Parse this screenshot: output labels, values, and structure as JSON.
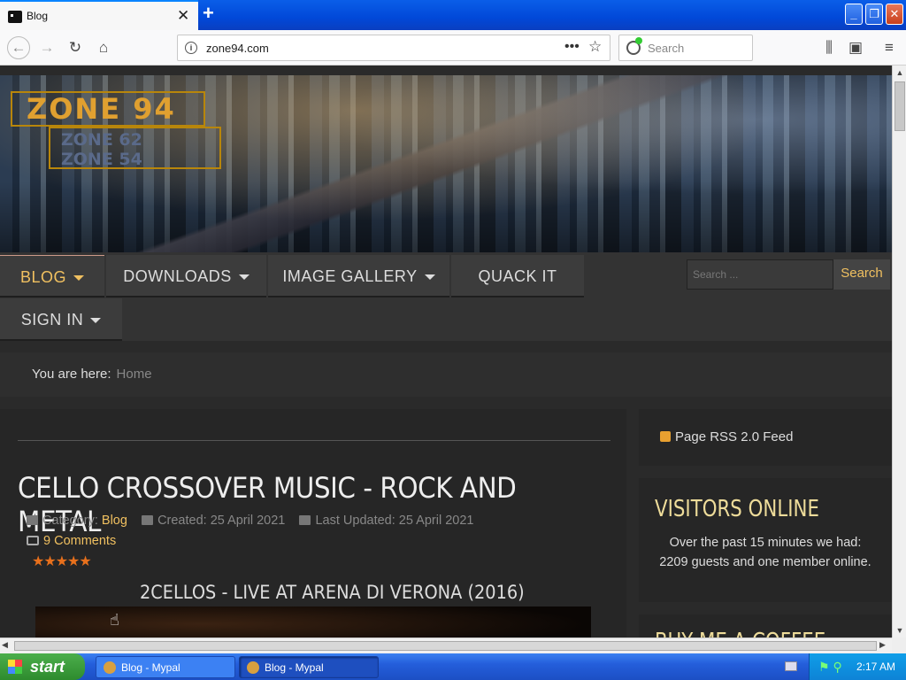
{
  "browser": {
    "tab_title": "Blog",
    "url": "zone94.com",
    "search_placeholder": "Search",
    "buttons": {
      "new_tab": "+",
      "tab_close": "✕",
      "minimize": "_",
      "maximize": "❐",
      "close": "✕"
    }
  },
  "site": {
    "logo_main": "ZONE 94",
    "logo_sub_1": "ZONE 62",
    "logo_sub_2": "ZONE 54",
    "menu": [
      {
        "label": "BLOG",
        "dropdown": true
      },
      {
        "label": "DOWNLOADS",
        "dropdown": true
      },
      {
        "label": "IMAGE GALLERY",
        "dropdown": true
      },
      {
        "label": "QUACK IT",
        "dropdown": false
      },
      {
        "label": "SIGN IN",
        "dropdown": true
      }
    ],
    "search_placeholder": "Search ...",
    "search_button": "Search",
    "breadcrumb_label": "You are here:",
    "breadcrumb_home": "Home"
  },
  "article": {
    "title": "CELLO CROSSOVER MUSIC - ROCK AND METAL",
    "category_label": "Category:",
    "category": "Blog",
    "created": "Created: 25 April 2021",
    "updated": "Last Updated: 25 April 2021",
    "comments": "9 Comments",
    "rating": 5,
    "rating_stars": "★★★★★",
    "video_title": "2CELLOS - LIVE AT ARENA DI VERONA (2016)"
  },
  "sidebar": {
    "rss": "Page RSS 2.0 Feed",
    "visitors_title": "VISITORS ONLINE",
    "visitors_text": "Over the past 15 minutes we had: 2209 guests and one member online.",
    "coffee_title": "BUY ME A COFFEE"
  },
  "taskbar": {
    "start": "start",
    "tasks": [
      "Blog - Mypal",
      "Blog - Mypal"
    ],
    "clock": "2:17 AM"
  },
  "colors": {
    "accent": "#f0c060",
    "background": "#2a2a2a",
    "taskbar": "#245edb"
  }
}
